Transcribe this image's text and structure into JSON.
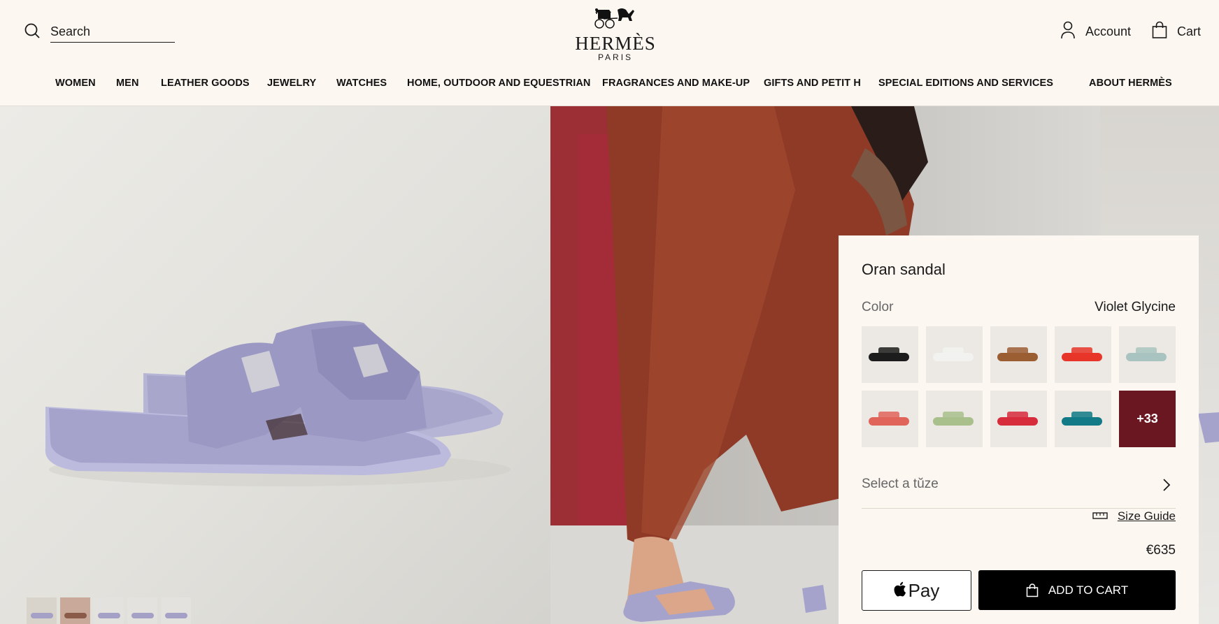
{
  "header": {
    "search_placeholder": "Search",
    "brand": "HERMÈS",
    "brand_city": "PARIS",
    "account_label": "Account",
    "cart_label": "Cart"
  },
  "nav": {
    "items": [
      {
        "label": "WOMEN"
      },
      {
        "label": "MEN"
      },
      {
        "label": "LEATHER GOODS"
      },
      {
        "label": "JEWELRY"
      },
      {
        "label": "WATCHES"
      },
      {
        "label": "HOME, OUTDOOR AND EQUESTRIAN"
      },
      {
        "label": "FRAGRANCES AND MAKE-UP"
      },
      {
        "label": "GIFTS AND PETIT H"
      },
      {
        "label": "SPECIAL EDITIONS AND SERVICES"
      },
      {
        "label": "ABOUT HERMÈS"
      }
    ]
  },
  "product": {
    "title": "Oran sandal",
    "color_label": "Color",
    "color_value": "Violet Glycine",
    "swatches": [
      {
        "name": "black",
        "color": "#1c1c1c"
      },
      {
        "name": "white",
        "color": "#f2f2f0"
      },
      {
        "name": "tan",
        "color": "#9b5d32"
      },
      {
        "name": "red",
        "color": "#e8352a"
      },
      {
        "name": "sage blue",
        "color": "#a9c4c0"
      },
      {
        "name": "coral",
        "color": "#e0645a"
      },
      {
        "name": "pistachio",
        "color": "#a9c08c"
      },
      {
        "name": "crimson",
        "color": "#d72c3c"
      },
      {
        "name": "teal",
        "color": "#117a86"
      },
      {
        "name": "more",
        "color": "#6b1721",
        "more_label": "+33"
      }
    ],
    "size_select_label": "Select a tŭze",
    "size_guide_label": "Size Guide",
    "price": "€635",
    "apple_pay_label": "Pay",
    "add_to_cart_label": "ADD TO CART"
  },
  "gallery": {
    "thumbnail_count": 5
  }
}
